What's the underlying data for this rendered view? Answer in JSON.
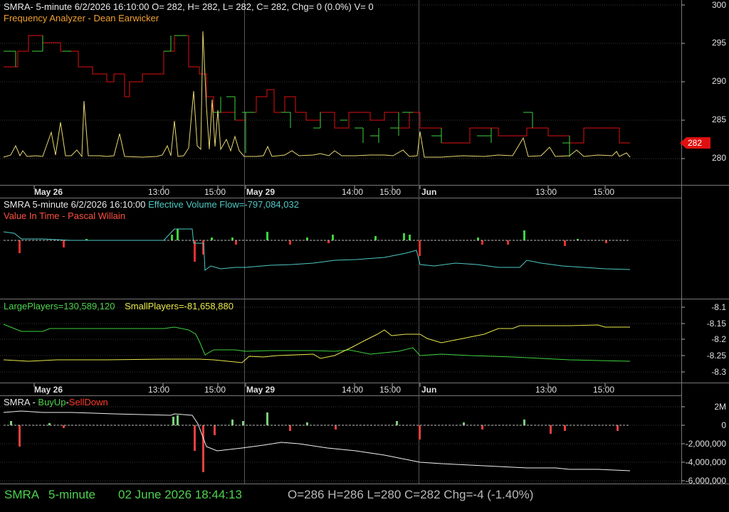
{
  "panel1": {
    "header": "SMRA- 5-minute 6/2/2026 16:10:00 O= 282, H= 282, L= 282, C= 282, Chg= 0 (0.0%) V= 0",
    "indicator": "Frequency Analyzer - Dean Earwicker",
    "yticks": [
      "300",
      "295",
      "290",
      "285",
      "280"
    ],
    "last_price": "282"
  },
  "xaxis1": {
    "labels": [
      "May 26",
      "13:00",
      "15:00",
      "May 29",
      "14:00",
      "15:00",
      "Jun",
      "13:00",
      "15:00"
    ]
  },
  "panel2": {
    "header_symbol": "SMRA 5-minute  6/2/2026 16:10:00",
    "header_value": "Effective Volume Flow=-797,084,032",
    "indicator": "Value In Time - Pascal Willain"
  },
  "panel3": {
    "large_label": "LargePlayers=130,589,120",
    "small_label": "SmallPlayers=-81,658,880",
    "yticks": [
      "-8.1",
      "-8.15",
      "-8.2",
      "-8.25",
      "-8.3"
    ]
  },
  "xaxis2": {
    "labels": [
      "May 26",
      "13:00",
      "15:00",
      "May 29",
      "14:00",
      "15:00",
      "Jun",
      "13:00",
      "15:00"
    ]
  },
  "panel4": {
    "symbol": "SMRA - ",
    "buy": "BuyUp",
    "dash": "-",
    "sell": "SellDown",
    "yticks": [
      "2M",
      "0",
      "-2,000,000",
      "-4,000,000",
      "-6,000,000"
    ]
  },
  "status": {
    "symbol": "SMRA",
    "interval": "5-minute",
    "datetime": "02 June 2026 18:44:13",
    "ohlc": "O=286  H=286  L=280  C=282  Chg=-4 (-1.40%)"
  },
  "chart_data": [
    {
      "type": "line",
      "title": "Frequency Analyzer - Dean Earwicker",
      "ylim": [
        277,
        301
      ],
      "series": [
        {
          "values": [
            293,
            295,
            295,
            296,
            295,
            294,
            291,
            294,
            293,
            294,
            295,
            296,
            292,
            287,
            286,
            286,
            285,
            285,
            286,
            284,
            283,
            283,
            284,
            283,
            283,
            282,
            282,
            282,
            282
          ]
        },
        {
          "values": [
            280.5,
            281,
            280,
            288,
            280,
            281,
            280,
            285,
            280.5,
            282,
            296,
            281,
            280.5,
            281,
            280.5,
            281,
            281,
            281,
            281.5,
            280.5,
            281,
            281,
            281,
            280.5,
            280.5,
            281,
            281,
            280.5,
            280.5
          ]
        }
      ]
    },
    {
      "type": "line",
      "title": "LargePlayers / SmallPlayers",
      "ylim": [
        -8.32,
        -8.1
      ],
      "series": [
        {
          "name": "LargePlayers=130,589,120",
          "values": [
            -8.15,
            -8.16,
            -8.16,
            -8.16,
            -8.155,
            -8.15,
            -8.16,
            -8.24,
            -8.23,
            -8.23,
            -8.22,
            -8.24,
            -8.24,
            -8.235,
            -8.23,
            -8.24,
            -8.24,
            -8.235,
            -8.22,
            -8.24,
            -8.24,
            -8.25,
            -8.25,
            -8.25,
            -8.25,
            -8.26,
            -8.27,
            -8.27
          ]
        },
        {
          "name": "SmallPlayers=-81,658,880",
          "values": [
            -8.27,
            -8.27,
            -8.27,
            -8.26,
            -8.27,
            -8.26,
            -8.26,
            -8.26,
            -8.26,
            -8.26,
            -8.25,
            -8.25,
            -8.24,
            -8.23,
            -8.2,
            -8.18,
            -8.18,
            -8.18,
            -8.19,
            -8.19,
            -8.2,
            -8.18,
            -8.16,
            -8.16,
            -8.155,
            -8.155,
            -8.16,
            -8.16
          ]
        }
      ]
    }
  ]
}
